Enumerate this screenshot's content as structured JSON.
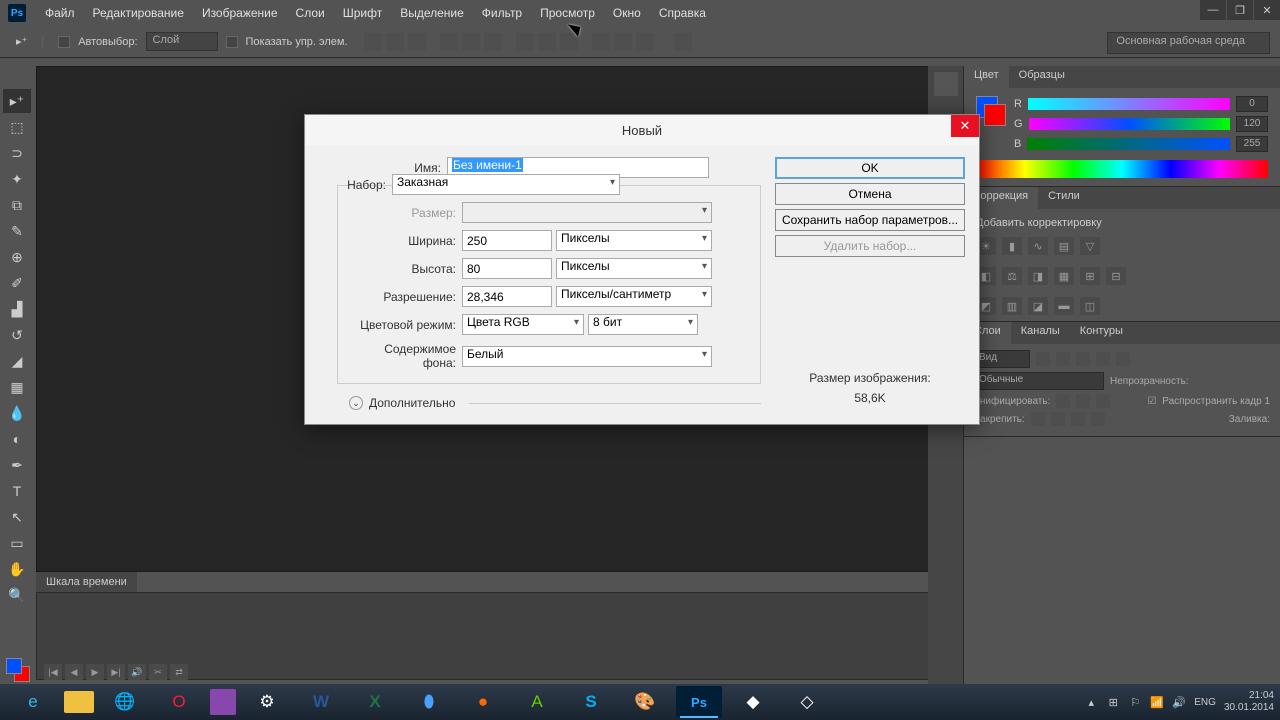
{
  "menu": [
    "Файл",
    "Редактирование",
    "Изображение",
    "Слои",
    "Шрифт",
    "Выделение",
    "Фильтр",
    "Просмотр",
    "Окно",
    "Справка"
  ],
  "toolbar": {
    "autoselect": "Автовыбор:",
    "layer": "Слой",
    "show_controls": "Показать упр. элем."
  },
  "workspace": "Основная рабочая среда",
  "panels": {
    "color_tab": "Цвет",
    "swatches_tab": "Образцы",
    "r": "R",
    "g": "G",
    "b": "B",
    "rv": "0",
    "gv": "120",
    "bv": "255",
    "corr_tab": "Коррекция",
    "styles_tab": "Стили",
    "add_adj": "Добавить корректировку",
    "layers_tab": "Слои",
    "channels_tab": "Каналы",
    "paths_tab": "Контуры",
    "kind": "Вид",
    "blend": "Обычные",
    "opacity": "Непрозрачность:",
    "unify": "Унифицировать:",
    "propagate": "Распространить кадр 1",
    "lock": "Закрепить:",
    "fill": "Заливка:"
  },
  "timeline": {
    "tab": "Шкала времени"
  },
  "dialog": {
    "title": "Новый",
    "name_label": "Имя:",
    "name_value": "Без имени-1",
    "preset_label": "Набор:",
    "preset_value": "Заказная",
    "size_label": "Размер:",
    "width_label": "Ширина:",
    "width_value": "250",
    "width_unit": "Пикселы",
    "height_label": "Высота:",
    "height_value": "80",
    "height_unit": "Пикселы",
    "res_label": "Разрешение:",
    "res_value": "28,346",
    "res_unit": "Пикселы/сантиметр",
    "mode_label": "Цветовой режим:",
    "mode_value": "Цвета RGB",
    "depth": "8 бит",
    "bg_label": "Содержимое фона:",
    "bg_value": "Белый",
    "advanced": "Дополнительно",
    "ok": "OK",
    "cancel": "Отмена",
    "save_preset": "Сохранить набор параметров...",
    "delete_preset": "Удалить набор...",
    "img_size_label": "Размер изображения:",
    "img_size_value": "58,6K"
  },
  "tray": {
    "lang": "ENG",
    "time": "21:04",
    "date": "30.01.2014"
  }
}
